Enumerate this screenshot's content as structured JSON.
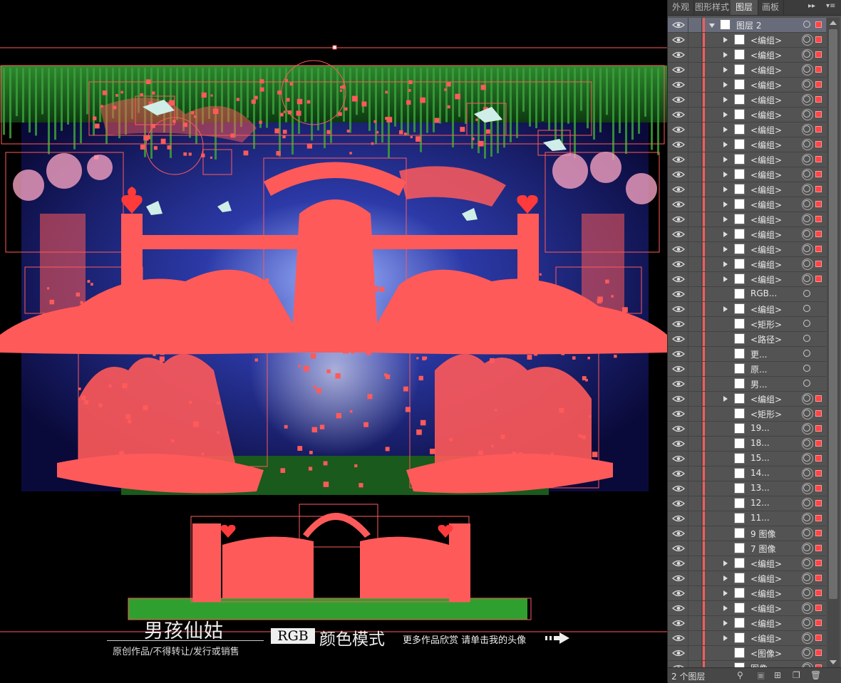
{
  "panel": {
    "tabs": [
      {
        "label": "外观",
        "active": false
      },
      {
        "label": "图形样式",
        "active": false
      },
      {
        "label": "图层",
        "active": true
      },
      {
        "label": "画板",
        "active": false
      }
    ],
    "collapse_label": "▸▸",
    "menu_label": "▾≡",
    "layers": [
      {
        "name": "图层 2",
        "expanded": true,
        "top": true,
        "arrow": true,
        "target_selected": false,
        "selected_square": true
      },
      {
        "name": "<编组>",
        "arrow": true,
        "target_selected": true,
        "selected_square": true
      },
      {
        "name": "<编组>",
        "arrow": true,
        "target_selected": true,
        "selected_square": true
      },
      {
        "name": "<编组>",
        "arrow": true,
        "target_selected": true,
        "selected_square": true
      },
      {
        "name": "<编组>",
        "arrow": true,
        "target_selected": true,
        "selected_square": true
      },
      {
        "name": "<编组>",
        "arrow": true,
        "target_selected": true,
        "selected_square": true
      },
      {
        "name": "<编组>",
        "arrow": true,
        "target_selected": true,
        "selected_square": true
      },
      {
        "name": "<编组>",
        "arrow": true,
        "target_selected": true,
        "selected_square": true
      },
      {
        "name": "<编组>",
        "arrow": true,
        "target_selected": true,
        "selected_square": true
      },
      {
        "name": "<编组>",
        "arrow": true,
        "target_selected": true,
        "selected_square": true
      },
      {
        "name": "<编组>",
        "arrow": true,
        "target_selected": true,
        "selected_square": true
      },
      {
        "name": "<编组>",
        "arrow": true,
        "target_selected": true,
        "selected_square": true
      },
      {
        "name": "<编组>",
        "arrow": true,
        "target_selected": true,
        "selected_square": true
      },
      {
        "name": "<编组>",
        "arrow": true,
        "target_selected": true,
        "selected_square": true
      },
      {
        "name": "<编组>",
        "arrow": true,
        "target_selected": true,
        "selected_square": true
      },
      {
        "name": "<编组>",
        "arrow": true,
        "target_selected": true,
        "selected_square": true
      },
      {
        "name": "<编组>",
        "arrow": true,
        "target_selected": true,
        "selected_square": true
      },
      {
        "name": "<编组>",
        "arrow": true,
        "target_selected": true,
        "selected_square": true
      },
      {
        "name": "RGB...",
        "arrow": false,
        "target_selected": false,
        "selected_square": false
      },
      {
        "name": "<编组>",
        "arrow": true,
        "target_selected": false,
        "selected_square": false
      },
      {
        "name": "<矩形>",
        "arrow": false,
        "target_selected": false,
        "selected_square": false
      },
      {
        "name": "<路径>",
        "arrow": false,
        "target_selected": false,
        "selected_square": false
      },
      {
        "name": "更...",
        "arrow": false,
        "target_selected": false,
        "selected_square": false
      },
      {
        "name": "原...",
        "arrow": false,
        "target_selected": false,
        "selected_square": false
      },
      {
        "name": "男...",
        "arrow": false,
        "target_selected": false,
        "selected_square": false
      },
      {
        "name": "<编组>",
        "arrow": true,
        "target_selected": true,
        "selected_square": true
      },
      {
        "name": "<矩形>",
        "arrow": false,
        "target_selected": true,
        "selected_square": true
      },
      {
        "name": "19...",
        "arrow": false,
        "target_selected": true,
        "selected_square": true
      },
      {
        "name": "18...",
        "arrow": false,
        "target_selected": true,
        "selected_square": true
      },
      {
        "name": "15...",
        "arrow": false,
        "target_selected": true,
        "selected_square": true
      },
      {
        "name": "14...",
        "arrow": false,
        "target_selected": true,
        "selected_square": true
      },
      {
        "name": "13...",
        "arrow": false,
        "target_selected": true,
        "selected_square": true
      },
      {
        "name": "12...",
        "arrow": false,
        "target_selected": true,
        "selected_square": true
      },
      {
        "name": "11...",
        "arrow": false,
        "target_selected": true,
        "selected_square": true
      },
      {
        "name": "9 图像",
        "arrow": false,
        "target_selected": true,
        "selected_square": true
      },
      {
        "name": "7 图像",
        "arrow": false,
        "target_selected": true,
        "selected_square": true
      },
      {
        "name": "<编组>",
        "arrow": true,
        "target_selected": true,
        "selected_square": true
      },
      {
        "name": "<编组>",
        "arrow": true,
        "target_selected": true,
        "selected_square": true
      },
      {
        "name": "<编组>",
        "arrow": true,
        "target_selected": true,
        "selected_square": true
      },
      {
        "name": "<编组>",
        "arrow": true,
        "target_selected": true,
        "selected_square": true
      },
      {
        "name": "<编组>",
        "arrow": true,
        "target_selected": true,
        "selected_square": true
      },
      {
        "name": "<编组>",
        "arrow": true,
        "target_selected": true,
        "selected_square": true
      },
      {
        "name": "<图像>",
        "arrow": false,
        "target_selected": true,
        "selected_square": true
      },
      {
        "name": "图像",
        "arrow": false,
        "target_selected": true,
        "selected_square": true
      }
    ],
    "footer_label": "2 个图层"
  },
  "canvas": {
    "title": "男孩仙姑",
    "subtitle": "原创作品/不得转让/发行或销售",
    "rgb_badge": "RGB",
    "color_mode": "颜色模式",
    "more_works": "更多作品欣赏 请单击我的头像"
  },
  "colors": {
    "selection": "#ff5a5a",
    "panel_bg": "#535353",
    "tab_bg": "#3c3c3c"
  }
}
